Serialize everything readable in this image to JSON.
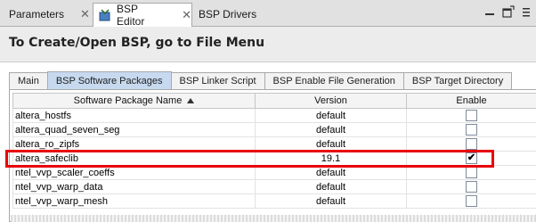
{
  "top_tabs": [
    {
      "label": "Parameters",
      "close": "✕"
    },
    {
      "label": "BSP Editor",
      "close": "✕"
    },
    {
      "label": "BSP Drivers",
      "close": ""
    }
  ],
  "header": {
    "title": "To Create/Open BSP, go to File Menu"
  },
  "inner_tabs": [
    "Main",
    "BSP Software Packages",
    "BSP Linker Script",
    "BSP Enable File Generation",
    "BSP Target Directory"
  ],
  "table": {
    "columns": [
      "Software Package Name",
      "Version",
      "Enable"
    ],
    "rows": [
      {
        "name": "altera_hostfs",
        "version": "default",
        "enabled": false
      },
      {
        "name": "altera_quad_seven_seg",
        "version": "default",
        "enabled": false
      },
      {
        "name": "altera_ro_zipfs",
        "version": "default",
        "enabled": false
      },
      {
        "name": "altera_safeclib",
        "version": "19.1",
        "enabled": true
      },
      {
        "name": "ntel_vvp_scaler_coeffs",
        "version": "default",
        "enabled": false
      },
      {
        "name": "ntel_vvp_warp_data",
        "version": "default",
        "enabled": false
      },
      {
        "name": "ntel_vvp_warp_mesh",
        "version": "default",
        "enabled": false
      }
    ],
    "check_glyph": "✔"
  },
  "colors": {
    "highlight": "#e8000a",
    "active_tab": "#c6d9ef"
  }
}
